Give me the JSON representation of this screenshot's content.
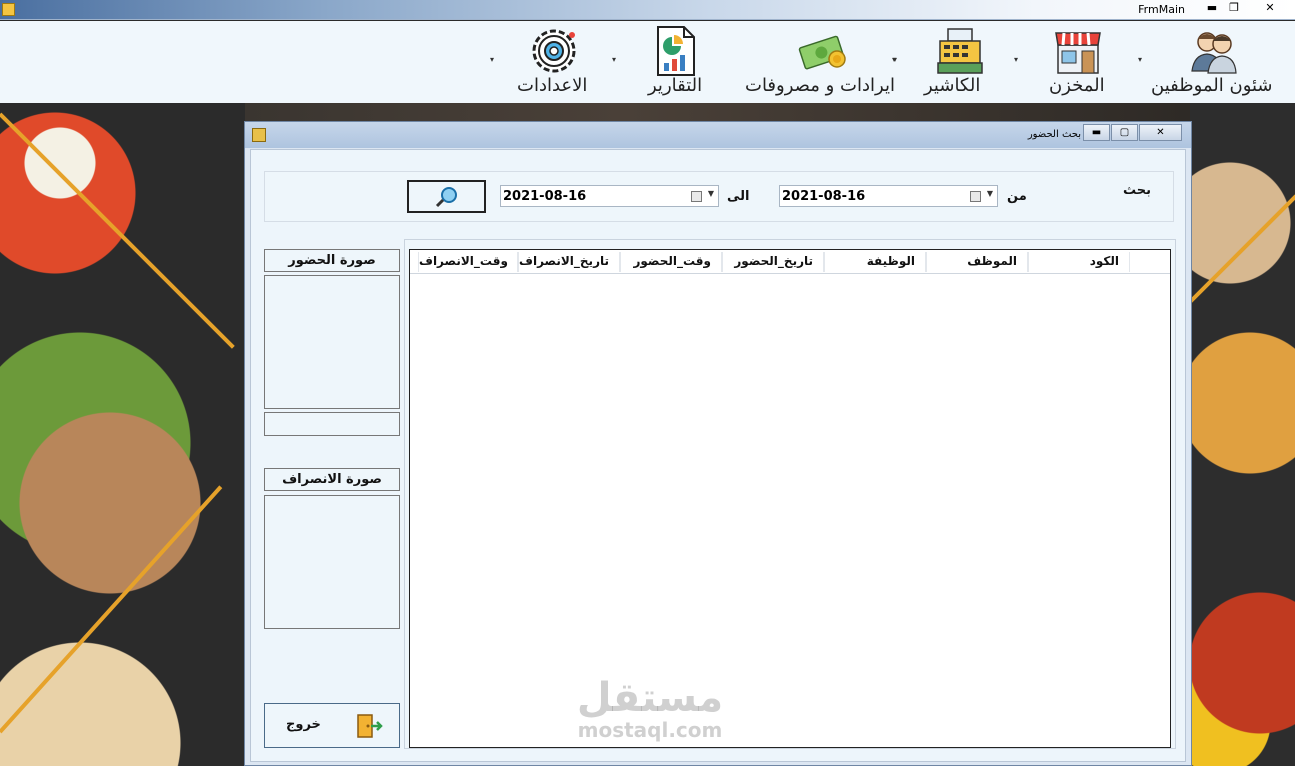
{
  "main_window": {
    "title": "FrmMain",
    "controls": {
      "minimize": "▬",
      "restore": "❐",
      "close": "✕"
    }
  },
  "menu": {
    "items": [
      {
        "label": "شئون الموظفين",
        "icon": "employees-icon"
      },
      {
        "label": "المخزن",
        "icon": "store-icon"
      },
      {
        "label": "الكاشير",
        "icon": "cash-register-icon"
      },
      {
        "label": "ايرادات و مصروفات",
        "icon": "money-icon"
      },
      {
        "label": "التقارير",
        "icon": "report-icon"
      },
      {
        "label": "الاعدادات",
        "icon": "settings-icon"
      }
    ],
    "caret": "▾"
  },
  "dialog": {
    "title": "بحث الحضور",
    "controls": {
      "minimize": "▬",
      "maximize": "▢",
      "close": "✕"
    },
    "search": {
      "caption": "بحث",
      "from_label": "من",
      "to_label": "الى",
      "from_date": "2021-08-16",
      "to_date": "2021-08-16"
    },
    "grid": {
      "columns": [
        "الكود",
        "الموظف",
        "الوظيفة",
        "تاريخ_الحضور",
        "وقت_الحضور",
        "تاريخ_الانصراف",
        "وقت_الانصراف"
      ]
    },
    "attendance_photo_label": "صورة الحضور",
    "leave_photo_label": "صورة الانصراف",
    "exit_label": "خروج"
  },
  "watermark": {
    "arabic": "مستقل",
    "latin": "mostaql.com"
  },
  "colors": {
    "accent": "#e6a22a",
    "window_bg": "#edf5fb",
    "frame": "#6f86a4"
  }
}
